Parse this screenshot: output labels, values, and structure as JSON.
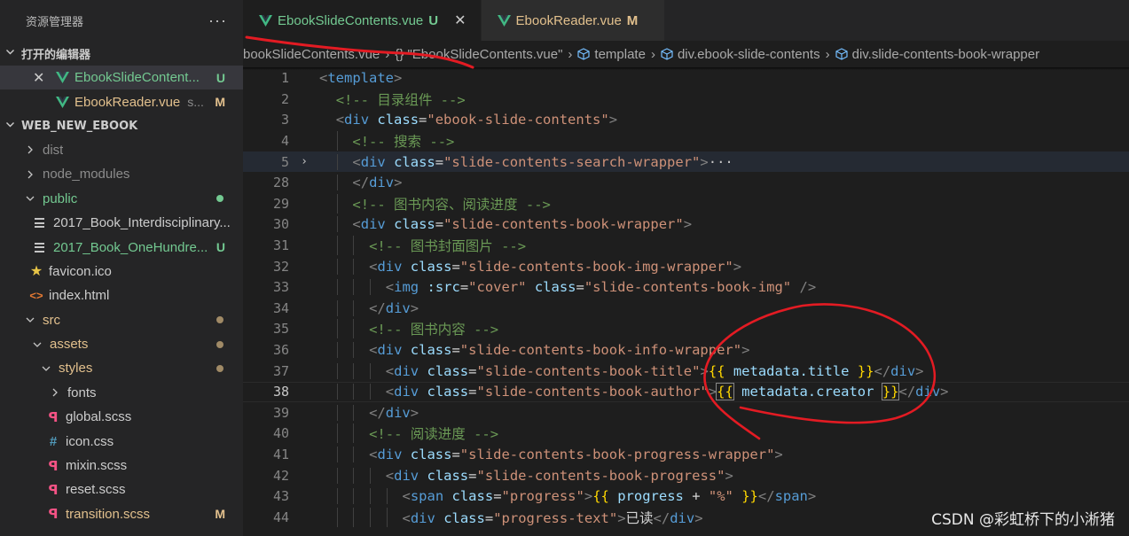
{
  "explorer": {
    "title": "资源管理器",
    "more": "···",
    "open_editors_label": "打开的编辑器",
    "open_editors": [
      {
        "label": "EbookSlideContent...",
        "status": "U"
      },
      {
        "label": "EbookReader.vue",
        "folder_hint": "s...",
        "status": "M"
      }
    ],
    "project_label": "WEB_NEW_EBOOK",
    "tree": [
      {
        "label": "dist"
      },
      {
        "label": "node_modules"
      },
      {
        "label": "public"
      },
      {
        "label": "2017_Book_Interdisciplinary..."
      },
      {
        "label": "2017_Book_OneHundre...",
        "status": "U"
      },
      {
        "label": "favicon.ico"
      },
      {
        "label": "index.html"
      },
      {
        "label": "src"
      },
      {
        "label": "assets"
      },
      {
        "label": "styles"
      },
      {
        "label": "fonts"
      },
      {
        "label": "global.scss"
      },
      {
        "label": "icon.css"
      },
      {
        "label": "mixin.scss"
      },
      {
        "label": "reset.scss"
      },
      {
        "label": "transition.scss",
        "status": "M"
      }
    ]
  },
  "tabs": [
    {
      "label": "EbookSlideContents.vue",
      "status": "U",
      "close": "✕",
      "active": true
    },
    {
      "label": "EbookReader.vue",
      "status": "M",
      "active": false
    }
  ],
  "breadcrumb": {
    "file": "bookSlideContents.vue",
    "sep": "›",
    "object": "{} \"EbookSlideContents.vue\"",
    "items": [
      "template",
      "div.ebook-slide-contents",
      "div.slide-contents-book-wrapper"
    ]
  },
  "editor": {
    "line_numbers": [
      "1",
      "2",
      "3",
      "4",
      "5",
      "28",
      "29",
      "30",
      "31",
      "32",
      "33",
      "34",
      "35",
      "36",
      "37",
      "38",
      "39",
      "40",
      "41",
      "42",
      "43",
      "44"
    ],
    "current_line": "38",
    "fold_marker": "›",
    "lines": [
      [
        [
          "br",
          "<"
        ],
        [
          "tag",
          "template"
        ],
        [
          "br",
          ">"
        ]
      ],
      [
        [
          "cmt",
          "<!-- 目录组件 -->"
        ]
      ],
      [
        [
          "br",
          "<"
        ],
        [
          "tag",
          "div"
        ],
        [
          "txt",
          " "
        ],
        [
          "attr",
          "class"
        ],
        [
          "txt",
          "="
        ],
        [
          "str",
          "\"ebook-slide-contents\""
        ],
        [
          "br",
          ">"
        ]
      ],
      [
        [
          "cmt",
          "<!-- 搜索 -->"
        ]
      ],
      [
        [
          "br",
          "<"
        ],
        [
          "tag",
          "div"
        ],
        [
          "txt",
          " "
        ],
        [
          "attr",
          "class"
        ],
        [
          "txt",
          "="
        ],
        [
          "str",
          "\"slide-contents-search-wrapper\""
        ],
        [
          "br",
          ">"
        ],
        [
          "ell",
          "···"
        ]
      ],
      [
        [
          "br",
          "</"
        ],
        [
          "tag",
          "div"
        ],
        [
          "br",
          ">"
        ]
      ],
      [
        [
          "cmt",
          "<!-- 图书内容、阅读进度 -->"
        ]
      ],
      [
        [
          "br",
          "<"
        ],
        [
          "tag",
          "div"
        ],
        [
          "txt",
          " "
        ],
        [
          "attr",
          "class"
        ],
        [
          "txt",
          "="
        ],
        [
          "str",
          "\"slide-contents-book-wrapper\""
        ],
        [
          "br",
          ">"
        ]
      ],
      [
        [
          "cmt",
          "<!-- 图书封面图片 -->"
        ]
      ],
      [
        [
          "br",
          "<"
        ],
        [
          "tag",
          "div"
        ],
        [
          "txt",
          " "
        ],
        [
          "attr",
          "class"
        ],
        [
          "txt",
          "="
        ],
        [
          "str",
          "\"slide-contents-book-img-wrapper\""
        ],
        [
          "br",
          ">"
        ]
      ],
      [
        [
          "br",
          "<"
        ],
        [
          "tag",
          "img"
        ],
        [
          "txt",
          " "
        ],
        [
          "attr",
          ":src"
        ],
        [
          "txt",
          "="
        ],
        [
          "str",
          "\"cover\""
        ],
        [
          "txt",
          " "
        ],
        [
          "attr",
          "class"
        ],
        [
          "txt",
          "="
        ],
        [
          "str",
          "\"slide-contents-book-img\""
        ],
        [
          "txt",
          " "
        ],
        [
          "br",
          "/>"
        ]
      ],
      [
        [
          "br",
          "</"
        ],
        [
          "tag",
          "div"
        ],
        [
          "br",
          ">"
        ]
      ],
      [
        [
          "cmt",
          "<!-- 图书内容 -->"
        ]
      ],
      [
        [
          "br",
          "<"
        ],
        [
          "tag",
          "div"
        ],
        [
          "txt",
          " "
        ],
        [
          "attr",
          "class"
        ],
        [
          "txt",
          "="
        ],
        [
          "str",
          "\"slide-contents-book-info-wrapper\""
        ],
        [
          "br",
          ">"
        ]
      ],
      [
        [
          "br",
          "<"
        ],
        [
          "tag",
          "div"
        ],
        [
          "txt",
          " "
        ],
        [
          "attr",
          "class"
        ],
        [
          "txt",
          "="
        ],
        [
          "str",
          "\"slide-contents-book-title\""
        ],
        [
          "br",
          ">"
        ],
        [
          "mus",
          "{{"
        ],
        [
          "txt",
          " "
        ],
        [
          "attr",
          "metadata.title"
        ],
        [
          "txt",
          " "
        ],
        [
          "mus",
          "}}"
        ],
        [
          "br",
          "</"
        ],
        [
          "tag",
          "div"
        ],
        [
          "br",
          ">"
        ]
      ],
      [
        [
          "br",
          "<"
        ],
        [
          "tag",
          "div"
        ],
        [
          "txt",
          " "
        ],
        [
          "attr",
          "class"
        ],
        [
          "txt",
          "="
        ],
        [
          "str",
          "\"slide-contents-book-author\""
        ],
        [
          "br",
          ">"
        ],
        [
          "musbm",
          "{{"
        ],
        [
          "txt",
          " "
        ],
        [
          "attr",
          "metadata.creator"
        ],
        [
          "txt",
          " "
        ],
        [
          "musbm",
          "}}"
        ],
        [
          "br",
          "</"
        ],
        [
          "tag",
          "div"
        ],
        [
          "br",
          ">"
        ]
      ],
      [
        [
          "br",
          "</"
        ],
        [
          "tag",
          "div"
        ],
        [
          "br",
          ">"
        ]
      ],
      [
        [
          "cmt",
          "<!-- 阅读进度 -->"
        ]
      ],
      [
        [
          "br",
          "<"
        ],
        [
          "tag",
          "div"
        ],
        [
          "txt",
          " "
        ],
        [
          "attr",
          "class"
        ],
        [
          "txt",
          "="
        ],
        [
          "str",
          "\"slide-contents-book-progress-wrapper\""
        ],
        [
          "br",
          ">"
        ]
      ],
      [
        [
          "br",
          "<"
        ],
        [
          "tag",
          "div"
        ],
        [
          "txt",
          " "
        ],
        [
          "attr",
          "class"
        ],
        [
          "txt",
          "="
        ],
        [
          "str",
          "\"slide-contents-book-progress\""
        ],
        [
          "br",
          ">"
        ]
      ],
      [
        [
          "br",
          "<"
        ],
        [
          "tag",
          "span"
        ],
        [
          "txt",
          " "
        ],
        [
          "attr",
          "class"
        ],
        [
          "txt",
          "="
        ],
        [
          "str",
          "\"progress\""
        ],
        [
          "br",
          ">"
        ],
        [
          "mus",
          "{{"
        ],
        [
          "txt",
          " "
        ],
        [
          "attr",
          "progress"
        ],
        [
          "txt",
          " + "
        ],
        [
          "str",
          "\"%\""
        ],
        [
          "txt",
          " "
        ],
        [
          "mus",
          "}}"
        ],
        [
          "br",
          "</"
        ],
        [
          "tag",
          "span"
        ],
        [
          "br",
          ">"
        ]
      ],
      [
        [
          "br",
          "<"
        ],
        [
          "tag",
          "div"
        ],
        [
          "txt",
          " "
        ],
        [
          "attr",
          "class"
        ],
        [
          "txt",
          "="
        ],
        [
          "str",
          "\"progress-text\""
        ],
        [
          "br",
          ">"
        ],
        [
          "txt",
          "已读"
        ],
        [
          "br",
          "</"
        ],
        [
          "tag",
          "div"
        ],
        [
          "br",
          ">"
        ]
      ]
    ]
  },
  "watermark": "CSDN @彩虹桥下的小淅猪",
  "colors": {
    "annotation": "#e31b23",
    "vue": "#41b883",
    "untracked": "#73c991",
    "modified": "#e2c08d"
  }
}
